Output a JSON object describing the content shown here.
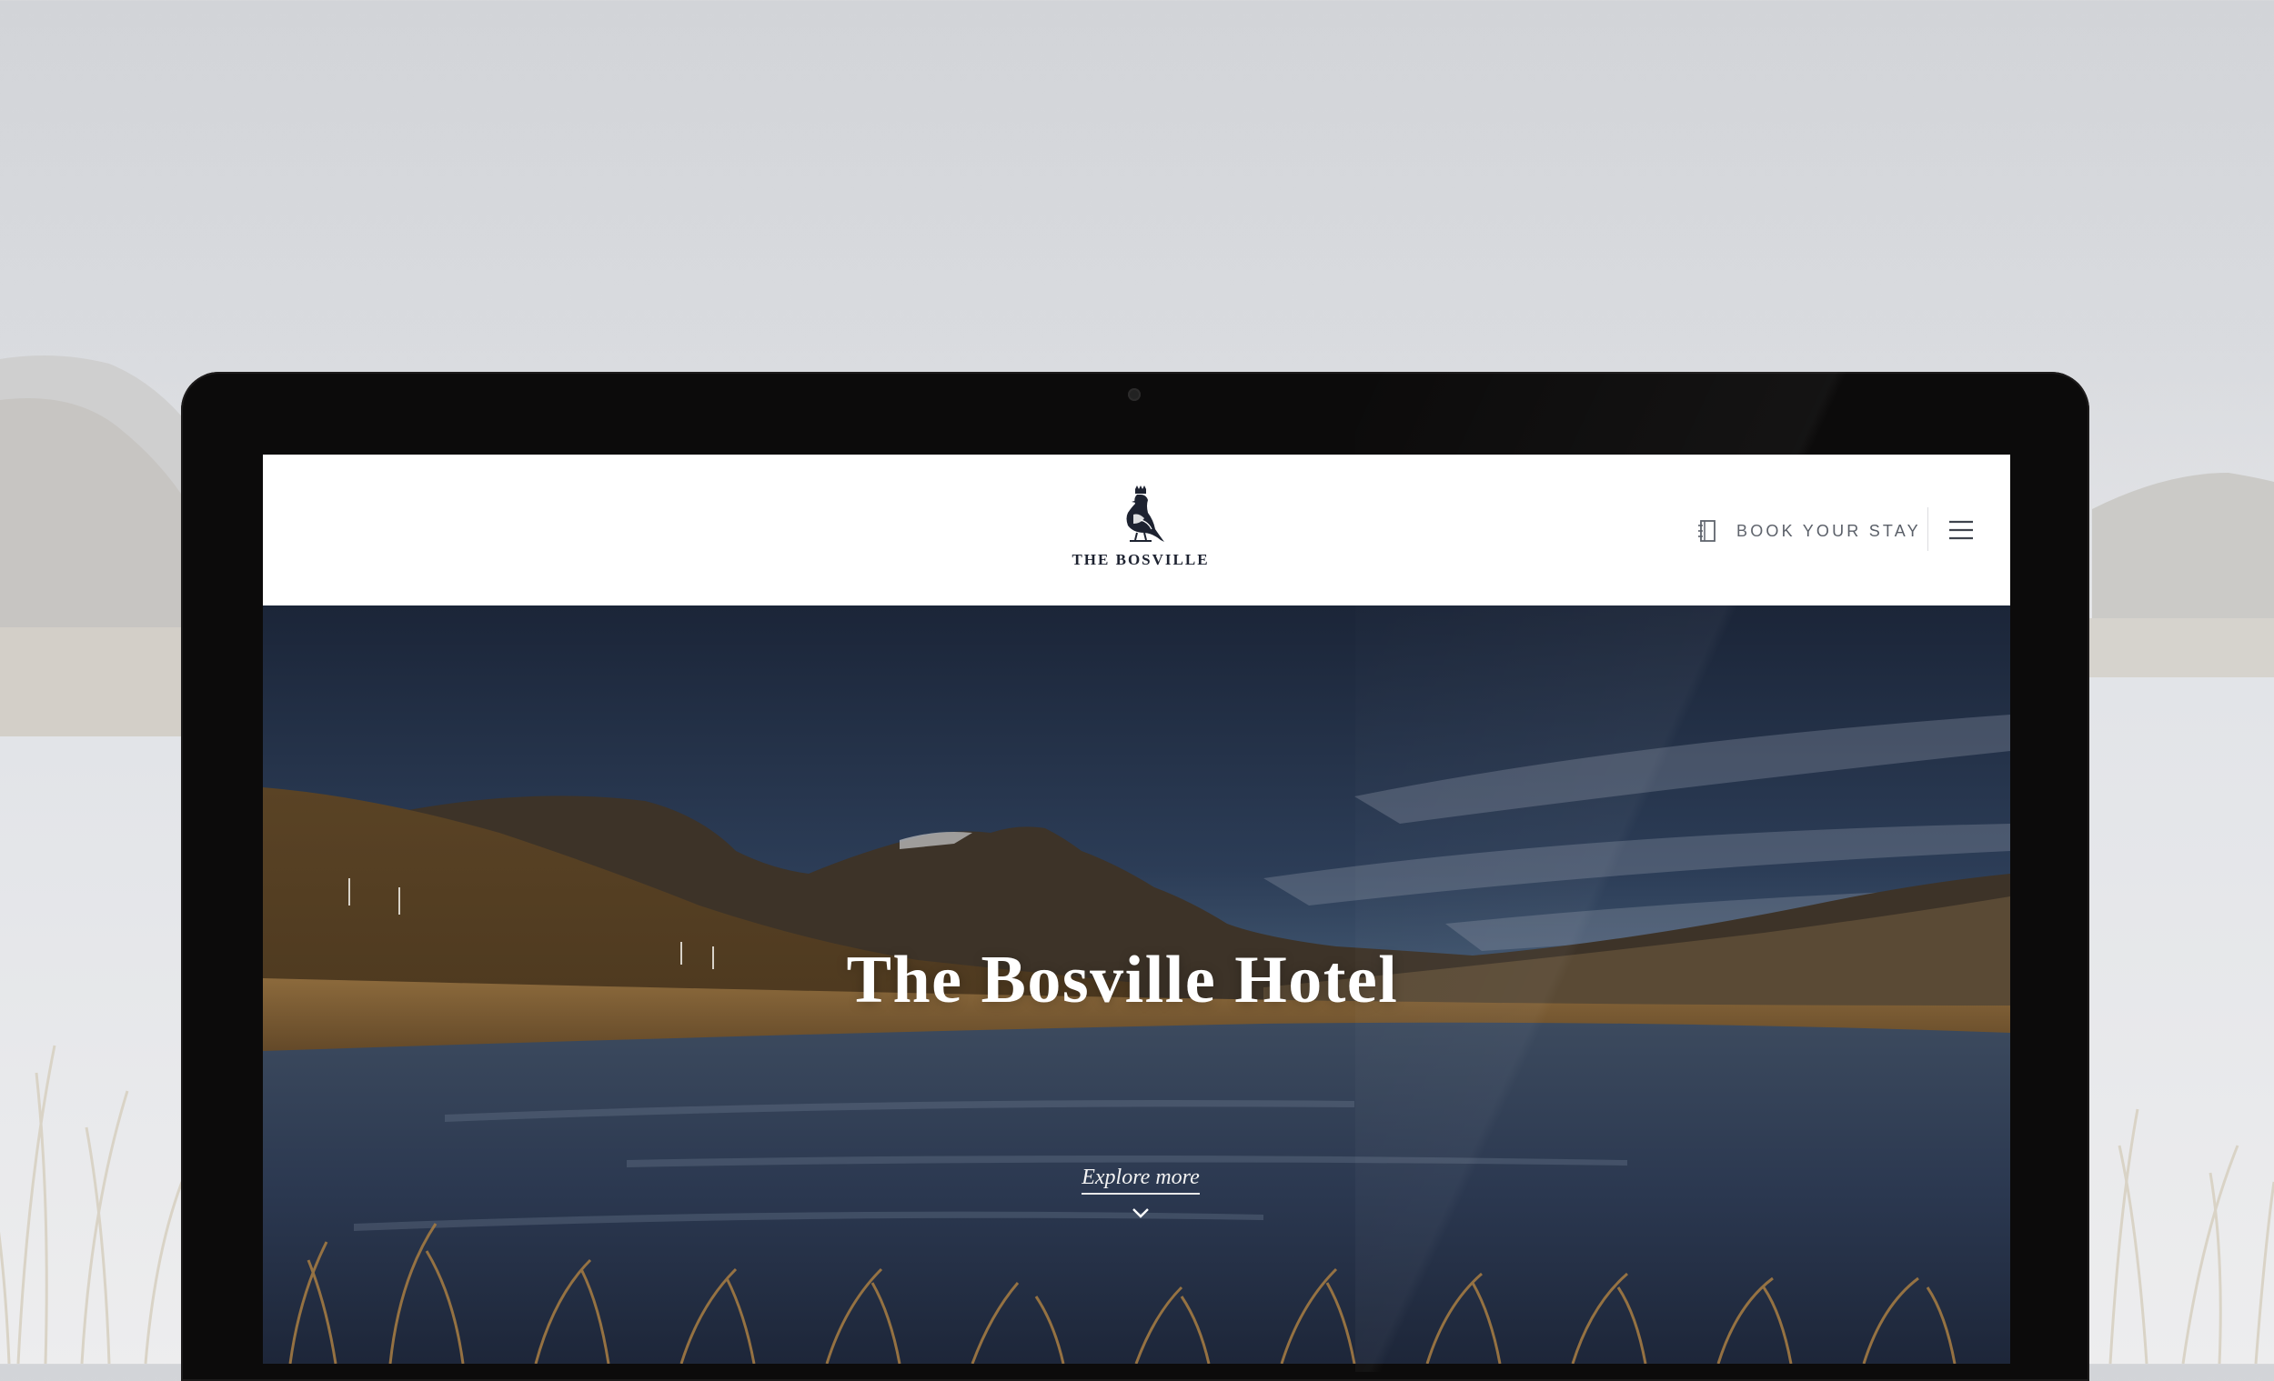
{
  "header": {
    "brand": "THE BOSVILLE",
    "book_label": "BOOK YOUR STAY",
    "book_icon": "booking-notebook-icon",
    "menu_icon": "hamburger-menu-icon",
    "logo_icon": "crowned-bird-emblem"
  },
  "hero": {
    "title": "The Bosville Hotel",
    "explore_label": "Explore more",
    "explore_icon": "chevron-down-icon"
  },
  "colors": {
    "header_background": "#ffffff",
    "brand_text": "#1d2230",
    "nav_text": "#5a5f68",
    "hero_text": "#ffffff",
    "device_frame": "#0c0b0b"
  }
}
